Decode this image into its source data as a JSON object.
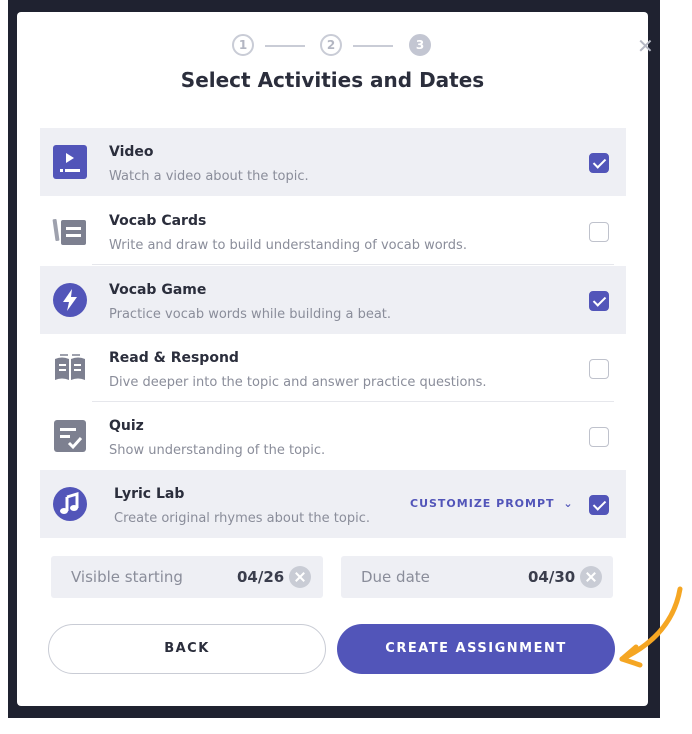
{
  "dialog": {
    "title": "Select Activities and Dates",
    "close_icon": "close-icon",
    "steps": [
      "1",
      "2",
      "3"
    ],
    "current_step": "3"
  },
  "activities": [
    {
      "name": "Video",
      "description": "Watch a video about the topic.",
      "checked": true,
      "icon": "video-icon"
    },
    {
      "name": "Vocab Cards",
      "description": "Write and draw to build understanding of vocab words.",
      "checked": false,
      "icon": "vocab-cards-icon"
    },
    {
      "name": "Vocab Game",
      "description": "Practice vocab words while building a beat.",
      "checked": true,
      "icon": "lightning-icon"
    },
    {
      "name": "Read & Respond",
      "description": "Dive deeper into the topic and answer practice questions.",
      "checked": false,
      "icon": "book-icon"
    },
    {
      "name": "Quiz",
      "description": "Show understanding of the topic.",
      "checked": false,
      "icon": "quiz-icon"
    },
    {
      "name": "Lyric Lab",
      "description": "Create original rhymes about the topic.",
      "checked": true,
      "icon": "music-note-icon",
      "action_label": "CUSTOMIZE PROMPT"
    }
  ],
  "dates": {
    "visible_label": "Visible starting",
    "visible_value": "04/26",
    "due_label": "Due date",
    "due_value": "04/30"
  },
  "buttons": {
    "back": "BACK",
    "create": "CREATE ASSIGNMENT"
  },
  "colors": {
    "accent": "#5255b9",
    "selected_row": "#eeeff4",
    "annotation_arrow": "#f5a623"
  }
}
